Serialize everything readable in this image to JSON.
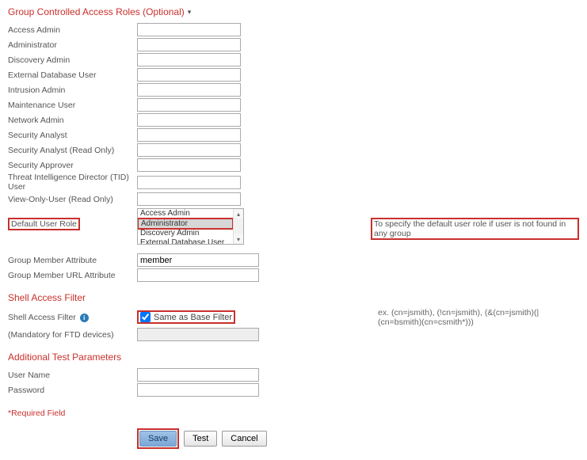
{
  "sections": {
    "groupRoles": "Group Controlled Access Roles (Optional)",
    "shellFilter": "Shell Access Filter",
    "additional": "Additional Test Parameters"
  },
  "roles": {
    "labels": [
      "Access Admin",
      "Administrator",
      "Discovery Admin",
      "External Database User",
      "Intrusion Admin",
      "Maintenance User",
      "Network Admin",
      "Security Analyst",
      "Security Analyst (Read Only)",
      "Security Approver",
      "Threat Intelligence Director (TID) User",
      "View-Only-User (Read Only)"
    ]
  },
  "defaultRole": {
    "label": "Default User Role",
    "options": [
      "Access Admin",
      "Administrator",
      "Discovery Admin",
      "External Database User"
    ],
    "helper": "To specify the default user role if user is not found in any group"
  },
  "groupMemberAttr": {
    "label": "Group Member Attribute",
    "value": "member"
  },
  "groupMemberUrlAttr": {
    "label": "Group Member URL Attribute",
    "value": ""
  },
  "shell": {
    "label": "Shell Access Filter",
    "checkbox": "Same as Base Filter",
    "mandatory": "(Mandatory for FTD devices)",
    "example": "ex. (cn=jsmith), (!cn=jsmith), (&(cn=jsmith)(|(cn=bsmith)(cn=csmith*)))"
  },
  "test": {
    "user": "User Name",
    "pass": "Password"
  },
  "required": "*Required Field",
  "buttons": {
    "save": "Save",
    "test": "Test",
    "cancel": "Cancel"
  }
}
